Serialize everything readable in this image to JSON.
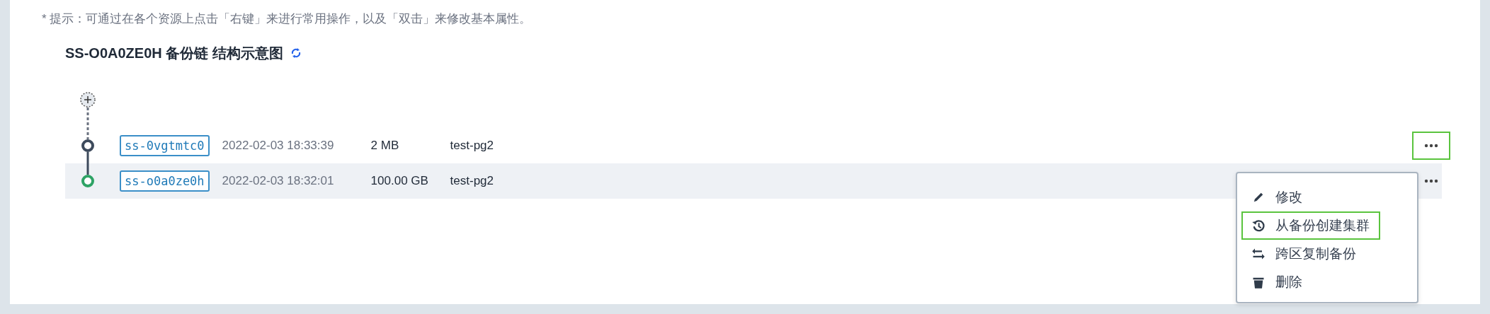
{
  "hint": "* 提示：可通过在各个资源上点击「右键」来进行常用操作，以及「双击」来修改基本属性。",
  "title": "SS-O0A0ZE0H 备份链 结构示意图",
  "rows": [
    {
      "id": "ss-0vgtmtc0",
      "time": "2022-02-03 18:33:39",
      "size": "2 MB",
      "name": "test-pg2",
      "color": "#3d4a5c",
      "selected": false,
      "more_highlighted": true
    },
    {
      "id": "ss-o0a0ze0h",
      "time": "2022-02-03 18:32:01",
      "size": "100.00 GB",
      "name": "test-pg2",
      "color": "#2ea365",
      "selected": true,
      "more_highlighted": false
    }
  ],
  "menu": [
    {
      "kind": "edit",
      "label": "修改",
      "highlighted": false
    },
    {
      "kind": "restore",
      "label": "从备份创建集群",
      "highlighted": true
    },
    {
      "kind": "copy",
      "label": "跨区复制备份",
      "highlighted": false
    },
    {
      "kind": "delete",
      "label": "删除",
      "highlighted": false
    }
  ]
}
